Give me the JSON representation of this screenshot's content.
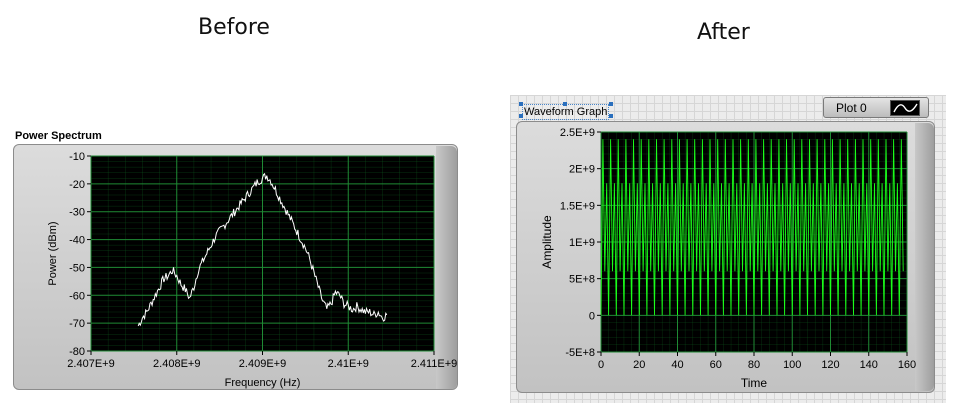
{
  "captions": {
    "before": "Before",
    "after": "After"
  },
  "colors": {
    "plot_bg": "#000000",
    "grid": "#0e5c1e",
    "trace_before": "#ffffff",
    "trace_after": "#1aff1a"
  },
  "chart_data": [
    {
      "type": "line",
      "title": "Power Spectrum",
      "xlabel": "Frequency (Hz)",
      "ylabel": "Power (dBm)",
      "xlim": [
        2407000000.0,
        2411000000.0
      ],
      "ylim": [
        -80,
        -10
      ],
      "x_tick_labels": [
        "2.407E+9",
        "2.408E+9",
        "2.409E+9",
        "2.41E+9",
        "2.411E+9"
      ],
      "y_tick_labels": [
        "-10",
        "-20",
        "-30",
        "-40",
        "-50",
        "-60",
        "-70",
        "-80"
      ],
      "grid": true,
      "series": [
        {
          "x": [
            2407550000.0,
            2407600000.0,
            2407650000.0,
            2407700000.0,
            2407750000.0,
            2407800000.0,
            2407850000.0,
            2407900000.0,
            2407950000.0,
            2408000000.0,
            2408050000.0,
            2408100000.0,
            2408150000.0,
            2408200000.0,
            2408250000.0,
            2408300000.0,
            2408350000.0,
            2408400000.0,
            2408450000.0,
            2408500000.0,
            2408550000.0,
            2408600000.0,
            2408650000.0,
            2408700000.0,
            2408750000.0,
            2408800000.0,
            2408850000.0,
            2408900000.0,
            2408950000.0,
            2409000000.0,
            2409050000.0,
            2409100000.0,
            2409150000.0,
            2409200000.0,
            2409250000.0,
            2409300000.0,
            2409350000.0,
            2409400000.0,
            2409450000.0,
            2409500000.0,
            2409550000.0,
            2409600000.0,
            2409650000.0,
            2409700000.0,
            2409750000.0,
            2409800000.0,
            2409850000.0,
            2409900000.0,
            2409950000.0,
            2410000000.0,
            2410050000.0,
            2410100000.0,
            2410150000.0,
            2410200000.0,
            2410250000.0,
            2410300000.0,
            2410350000.0,
            2410400000.0,
            2410450000.0
          ],
          "y": [
            -71,
            -68,
            -66,
            -63,
            -60,
            -57,
            -54,
            -53,
            -51,
            -53,
            -56,
            -58,
            -61,
            -57,
            -51,
            -48,
            -45,
            -42,
            -39,
            -37,
            -35,
            -33,
            -31,
            -29,
            -27,
            -25,
            -23,
            -21,
            -19,
            -18,
            -17,
            -19,
            -22,
            -25,
            -28,
            -31,
            -34,
            -37,
            -40,
            -43,
            -47,
            -52,
            -57,
            -62,
            -65,
            -63,
            -59,
            -60,
            -63,
            -64,
            -65,
            -64,
            -65,
            -66,
            -66,
            -67,
            -66,
            -68,
            -67
          ]
        }
      ]
    },
    {
      "type": "line",
      "title": "Waveform Graph",
      "xlabel": "Time",
      "ylabel": "Amplitude",
      "xlim": [
        0,
        160
      ],
      "ylim": [
        -500000000.0,
        2500000000.0
      ],
      "x_tick_labels": [
        "0",
        "20",
        "40",
        "60",
        "80",
        "100",
        "120",
        "140",
        "160"
      ],
      "y_tick_labels": [
        "2.5E+9",
        "2E+9",
        "1.5E+9",
        "1E+9",
        "5E+8",
        "0",
        "-5E+8"
      ],
      "grid": true,
      "legend": "top-right",
      "legend_label": "Plot 0",
      "series": [
        {
          "description_levels": [
            0,
            600000000.0,
            1800000000.0,
            2400000000.0
          ],
          "x_range": [
            0,
            158
          ],
          "sample_period": 2
        }
      ]
    }
  ]
}
